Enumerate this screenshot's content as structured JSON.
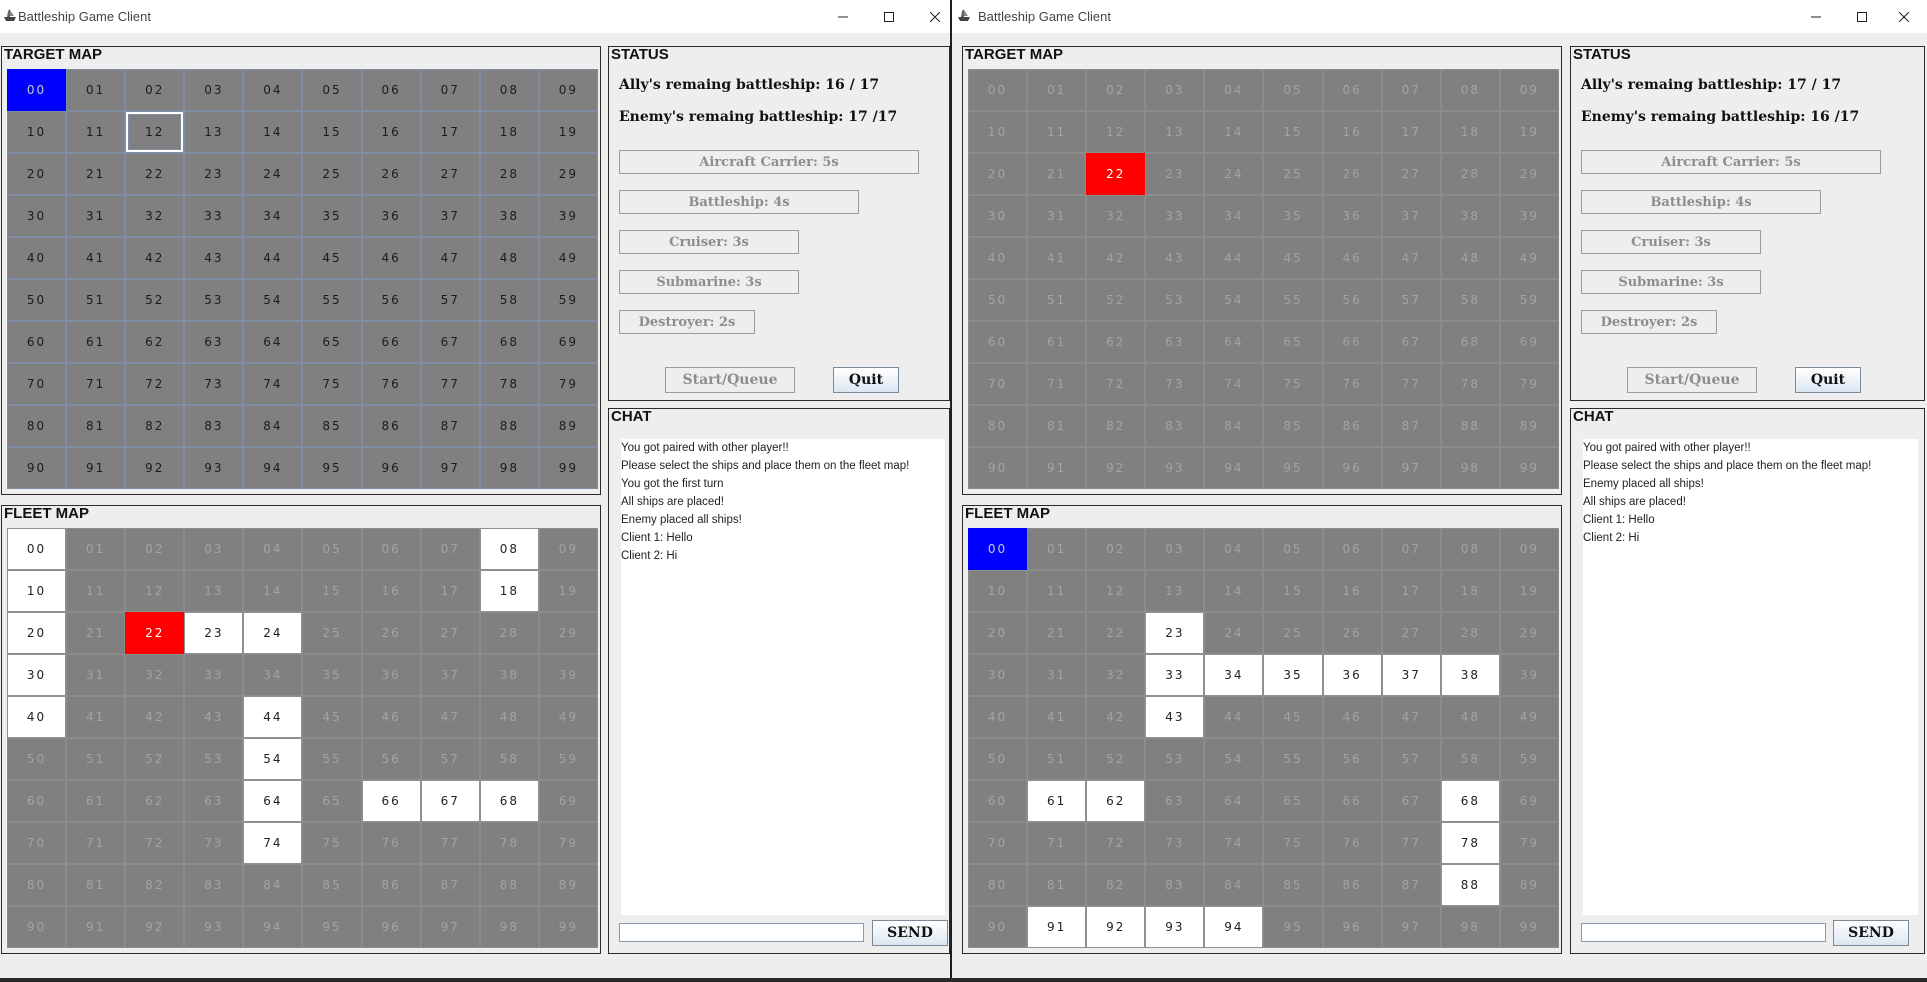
{
  "windows": [
    {
      "id": "left",
      "title": "Battleship Game Client",
      "target_map": {
        "label": "TARGET MAP",
        "cells": [
          "00",
          "01",
          "02",
          "03",
          "04",
          "05",
          "06",
          "07",
          "08",
          "09",
          "10",
          "11",
          "12",
          "13",
          "14",
          "15",
          "16",
          "17",
          "18",
          "19",
          "20",
          "21",
          "22",
          "23",
          "24",
          "25",
          "26",
          "27",
          "28",
          "29",
          "30",
          "31",
          "32",
          "33",
          "34",
          "35",
          "36",
          "37",
          "38",
          "39",
          "40",
          "41",
          "42",
          "43",
          "44",
          "45",
          "46",
          "47",
          "48",
          "49",
          "50",
          "51",
          "52",
          "53",
          "54",
          "55",
          "56",
          "57",
          "58",
          "59",
          "60",
          "61",
          "62",
          "63",
          "64",
          "65",
          "66",
          "67",
          "68",
          "69",
          "70",
          "71",
          "72",
          "73",
          "74",
          "75",
          "76",
          "77",
          "78",
          "79",
          "80",
          "81",
          "82",
          "83",
          "84",
          "85",
          "86",
          "87",
          "88",
          "89",
          "90",
          "91",
          "92",
          "93",
          "94",
          "95",
          "96",
          "97",
          "98",
          "99"
        ],
        "enabled": true,
        "selected": [
          "00"
        ],
        "hits": [],
        "focused": [
          "12"
        ]
      },
      "fleet_map": {
        "label": "FLEET MAP",
        "cells": [
          "00",
          "01",
          "02",
          "03",
          "04",
          "05",
          "06",
          "07",
          "08",
          "09",
          "10",
          "11",
          "12",
          "13",
          "14",
          "15",
          "16",
          "17",
          "18",
          "19",
          "20",
          "21",
          "22",
          "23",
          "24",
          "25",
          "26",
          "27",
          "28",
          "29",
          "30",
          "31",
          "32",
          "33",
          "34",
          "35",
          "36",
          "37",
          "38",
          "39",
          "40",
          "41",
          "42",
          "43",
          "44",
          "45",
          "46",
          "47",
          "48",
          "49",
          "50",
          "51",
          "52",
          "53",
          "54",
          "55",
          "56",
          "57",
          "58",
          "59",
          "60",
          "61",
          "62",
          "63",
          "64",
          "65",
          "66",
          "67",
          "68",
          "69",
          "70",
          "71",
          "72",
          "73",
          "74",
          "75",
          "76",
          "77",
          "78",
          "79",
          "80",
          "81",
          "82",
          "83",
          "84",
          "85",
          "86",
          "87",
          "88",
          "89",
          "90",
          "91",
          "92",
          "93",
          "94",
          "95",
          "96",
          "97",
          "98",
          "99"
        ],
        "ships": [
          "00",
          "08",
          "10",
          "18",
          "20",
          "23",
          "24",
          "30",
          "40",
          "44",
          "54",
          "64",
          "66",
          "67",
          "68",
          "74"
        ],
        "hits": [
          "22"
        ],
        "selected": []
      },
      "status": {
        "label": "STATUS",
        "ally": "Ally's remaing battleship: 16 / 17",
        "enemy": "Enemy's remaing battleship: 17 /17",
        "ships": [
          "Aircraft Carrier: 5s",
          "Battleship: 4s",
          "Cruiser: 3s",
          "Submarine: 3s",
          "Destroyer: 2s"
        ],
        "start_label": "Start/Queue",
        "quit_label": "Quit"
      },
      "chat": {
        "label": "CHAT",
        "messages": [
          "You got paired with other player!!",
          "Please select the ships and place them on the fleet map!",
          "You got the first turn",
          "All ships are placed!",
          "Enemy placed all ships!",
          "Client 1: Hello",
          "Client 2: Hi"
        ],
        "input_value": "",
        "send_label": "SEND"
      }
    },
    {
      "id": "right",
      "title": "Battleship Game Client",
      "target_map": {
        "label": "TARGET MAP",
        "cells": [
          "00",
          "01",
          "02",
          "03",
          "04",
          "05",
          "06",
          "07",
          "08",
          "09",
          "10",
          "11",
          "12",
          "13",
          "14",
          "15",
          "16",
          "17",
          "18",
          "19",
          "20",
          "21",
          "22",
          "23",
          "24",
          "25",
          "26",
          "27",
          "28",
          "29",
          "30",
          "31",
          "32",
          "33",
          "34",
          "35",
          "36",
          "37",
          "38",
          "39",
          "40",
          "41",
          "42",
          "43",
          "44",
          "45",
          "46",
          "47",
          "48",
          "49",
          "50",
          "51",
          "52",
          "53",
          "54",
          "55",
          "56",
          "57",
          "58",
          "59",
          "60",
          "61",
          "62",
          "63",
          "64",
          "65",
          "66",
          "67",
          "68",
          "69",
          "70",
          "71",
          "72",
          "73",
          "74",
          "75",
          "76",
          "77",
          "78",
          "79",
          "80",
          "81",
          "82",
          "83",
          "84",
          "85",
          "86",
          "87",
          "88",
          "89",
          "90",
          "91",
          "92",
          "93",
          "94",
          "95",
          "96",
          "97",
          "98",
          "99"
        ],
        "enabled": false,
        "selected": [],
        "hits": [
          "22"
        ],
        "focused": []
      },
      "fleet_map": {
        "label": "FLEET MAP",
        "cells": [
          "00",
          "01",
          "02",
          "03",
          "04",
          "05",
          "06",
          "07",
          "08",
          "09",
          "10",
          "11",
          "12",
          "13",
          "14",
          "15",
          "16",
          "17",
          "18",
          "19",
          "20",
          "21",
          "22",
          "23",
          "24",
          "25",
          "26",
          "27",
          "28",
          "29",
          "30",
          "31",
          "32",
          "33",
          "34",
          "35",
          "36",
          "37",
          "38",
          "39",
          "40",
          "41",
          "42",
          "43",
          "44",
          "45",
          "46",
          "47",
          "48",
          "49",
          "50",
          "51",
          "52",
          "53",
          "54",
          "55",
          "56",
          "57",
          "58",
          "59",
          "60",
          "61",
          "62",
          "63",
          "64",
          "65",
          "66",
          "67",
          "68",
          "69",
          "70",
          "71",
          "72",
          "73",
          "74",
          "75",
          "76",
          "77",
          "78",
          "79",
          "80",
          "81",
          "82",
          "83",
          "84",
          "85",
          "86",
          "87",
          "88",
          "89",
          "90",
          "91",
          "92",
          "93",
          "94",
          "95",
          "96",
          "97",
          "98",
          "99"
        ],
        "ships": [
          "23",
          "33",
          "34",
          "35",
          "36",
          "37",
          "38",
          "43",
          "61",
          "62",
          "68",
          "78",
          "88",
          "91",
          "92",
          "93",
          "94"
        ],
        "hits": [],
        "selected": [
          "00"
        ]
      },
      "status": {
        "label": "STATUS",
        "ally": "Ally's remaing battleship: 17 / 17",
        "enemy": "Enemy's remaing battleship: 16 /17",
        "ships": [
          "Aircraft Carrier: 5s",
          "Battleship: 4s",
          "Cruiser: 3s",
          "Submarine: 3s",
          "Destroyer: 2s"
        ],
        "start_label": "Start/Queue",
        "quit_label": "Quit"
      },
      "chat": {
        "label": "CHAT",
        "messages": [
          "You got paired with other player!!",
          "Please select the ships and place them on the fleet map!",
          "Enemy placed all ships!",
          "All ships are placed!",
          "Client 1: Hello",
          "Client 2: Hi"
        ],
        "input_value": "",
        "send_label": "SEND"
      }
    }
  ],
  "colors": {
    "water": "#808080",
    "hit": "#ff0000",
    "selected": "#0000ff",
    "ship": "#ffffff"
  },
  "icons": {
    "app": "battleship-app-icon",
    "minimize": "minimize-icon",
    "maximize": "maximize-icon",
    "close": "close-icon"
  }
}
